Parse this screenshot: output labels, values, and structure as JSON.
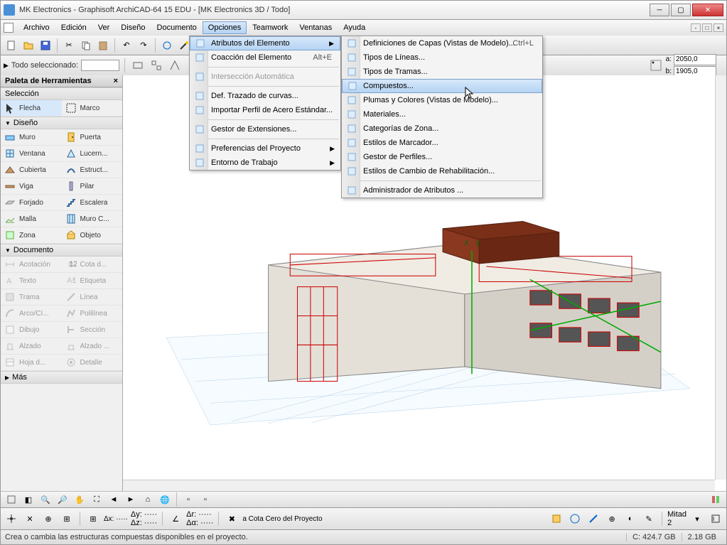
{
  "title": "MK Electronics - Graphisoft ArchiCAD-64 15 EDU - [MK Electronics 3D / Todo]",
  "menus": [
    "Archivo",
    "Edición",
    "Ver",
    "Diseño",
    "Documento",
    "Opciones",
    "Teamwork",
    "Ventanas",
    "Ayuda"
  ],
  "active_menu": "Opciones",
  "infobar": {
    "label": "Todo seleccionado:"
  },
  "dims": {
    "a_label": "a:",
    "a_value": "2050,0",
    "b_label": "b:",
    "b_value": "1905,0"
  },
  "palette": {
    "title": "Paleta de Herramientas",
    "sections": {
      "seleccion": {
        "title": "Selección",
        "items": [
          {
            "label": "Flecha",
            "icon": "cursor"
          },
          {
            "label": "Marco",
            "icon": "marquee"
          }
        ]
      },
      "diseno": {
        "title": "Diseño",
        "items": [
          {
            "label": "Muro",
            "icon": "wall"
          },
          {
            "label": "Puerta",
            "icon": "door"
          },
          {
            "label": "Ventana",
            "icon": "window"
          },
          {
            "label": "Lucern...",
            "icon": "skylight"
          },
          {
            "label": "Cubierta",
            "icon": "roof"
          },
          {
            "label": "Estruct...",
            "icon": "shell"
          },
          {
            "label": "Viga",
            "icon": "beam"
          },
          {
            "label": "Pilar",
            "icon": "column"
          },
          {
            "label": "Forjado",
            "icon": "slab"
          },
          {
            "label": "Escalera",
            "icon": "stair"
          },
          {
            "label": "Malla",
            "icon": "mesh"
          },
          {
            "label": "Muro C...",
            "icon": "curtain"
          },
          {
            "label": "Zona",
            "icon": "zone"
          },
          {
            "label": "Objeto",
            "icon": "object"
          }
        ]
      },
      "documento": {
        "title": "Documento",
        "items": [
          {
            "label": "Acotación",
            "icon": "dim"
          },
          {
            "label": "Cota d...",
            "icon": "level"
          },
          {
            "label": "Texto",
            "icon": "text"
          },
          {
            "label": "Etiqueta",
            "icon": "label"
          },
          {
            "label": "Trama",
            "icon": "fill"
          },
          {
            "label": "Línea",
            "icon": "line"
          },
          {
            "label": "Arco/Cí...",
            "icon": "arc"
          },
          {
            "label": "Polilínea",
            "icon": "poly"
          },
          {
            "label": "Dibujo",
            "icon": "drawing"
          },
          {
            "label": "Sección",
            "icon": "section"
          },
          {
            "label": "Alzado",
            "icon": "elevation"
          },
          {
            "label": "Alzado ...",
            "icon": "intelev"
          },
          {
            "label": "Hoja d...",
            "icon": "worksheet"
          },
          {
            "label": "Detalle",
            "icon": "detail"
          }
        ]
      },
      "mas": {
        "title": "Más"
      }
    }
  },
  "dropdown1": [
    {
      "label": "Atributos del Elemento",
      "arrow": true,
      "hl": true
    },
    {
      "label": "Coacción del Elemento",
      "shortcut": "Alt+E"
    },
    {
      "sep": true
    },
    {
      "label": "Intersección Automática",
      "disabled": true
    },
    {
      "sep": true
    },
    {
      "label": "Def. Trazado de curvas..."
    },
    {
      "label": "Importar Perfil de Acero Estándar..."
    },
    {
      "sep": true
    },
    {
      "label": "Gestor de Extensiones..."
    },
    {
      "sep": true
    },
    {
      "label": "Preferencias del Proyecto",
      "arrow": true
    },
    {
      "label": "Entorno de Trabajo",
      "arrow": true
    }
  ],
  "dropdown2": [
    {
      "label": "Definiciones de Capas (Vistas de Modelo)...",
      "shortcut": "Ctrl+L"
    },
    {
      "label": "Tipos de Líneas..."
    },
    {
      "label": "Tipos de Tramas..."
    },
    {
      "label": "Compuestos...",
      "hl": true
    },
    {
      "label": "Plumas y Colores (Vistas de Modelo)..."
    },
    {
      "label": "Materiales..."
    },
    {
      "label": "Categorías de Zona..."
    },
    {
      "label": "Estilos de Marcador..."
    },
    {
      "label": "Gestor de Perfiles..."
    },
    {
      "label": "Estilos de Cambio de Rehabilitación..."
    },
    {
      "sep": true
    },
    {
      "label": "Administrador de Atributos ..."
    }
  ],
  "bottom_coord": {
    "dx": "Δx: ·····",
    "dy": "Δy: ·····",
    "dz": "Δz: ·····",
    "dr": "Δr: ·····",
    "da": "Δα: ·····",
    "origin": "a Cota Cero del Proyecto",
    "scale": "Mitad",
    "scale_val": "2"
  },
  "status": {
    "text": "Crea o cambia las estructuras compuestas disponibles en el proyecto.",
    "disk_c": "C: 424.7 GB",
    "mem": "2.18 GB"
  }
}
